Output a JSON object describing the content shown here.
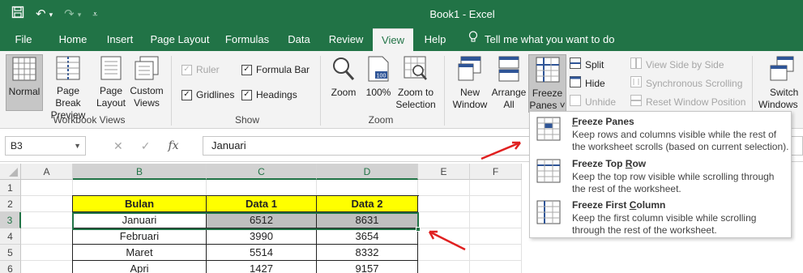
{
  "window": {
    "title": "Book1  -  Excel"
  },
  "menu": {
    "tabs": [
      {
        "label": "File"
      },
      {
        "label": "Home"
      },
      {
        "label": "Insert"
      },
      {
        "label": "Page Layout"
      },
      {
        "label": "Formulas"
      },
      {
        "label": "Data"
      },
      {
        "label": "Review"
      },
      {
        "label": "View",
        "active": true
      },
      {
        "label": "Help"
      }
    ],
    "tell_me": "Tell me what you want to do"
  },
  "ribbon": {
    "workbook_views": {
      "label": "Workbook Views",
      "normal": "Normal",
      "page_break_1": "Page Break",
      "page_break_2": "Preview",
      "page_layout_1": "Page",
      "page_layout_2": "Layout",
      "custom_1": "Custom",
      "custom_2": "Views"
    },
    "show": {
      "label": "Show",
      "ruler": "Ruler",
      "formula_bar": "Formula Bar",
      "gridlines": "Gridlines",
      "headings": "Headings"
    },
    "zoom": {
      "label": "Zoom",
      "zoom": "Zoom",
      "hundred": "100%",
      "zoom_sel_1": "Zoom to",
      "zoom_sel_2": "Selection"
    },
    "window": {
      "new_window_1": "New",
      "new_window_2": "Window",
      "arrange_1": "Arrange",
      "arrange_2": "All",
      "freeze_1": "Freeze",
      "freeze_2": "Panes ˅",
      "split": "Split",
      "hide": "Hide",
      "unhide": "Unhide",
      "side_by_side": "View Side by Side",
      "sync_scroll": "Synchronous Scrolling",
      "reset_pos": "Reset Window Position",
      "switch_1": "Switch",
      "switch_2": "Windows"
    }
  },
  "formula_bar": {
    "name_box": "B3",
    "value": "Januari",
    "fx": "fx"
  },
  "grid": {
    "columns": [
      "A",
      "B",
      "C",
      "D",
      "E",
      "F"
    ],
    "rows": [
      "1",
      "2",
      "3",
      "4",
      "5",
      "6"
    ],
    "table_header": [
      "Bulan",
      "Data 1",
      "Data 2"
    ],
    "table_rows": [
      [
        "Januari",
        "6512",
        "8631"
      ],
      [
        "Februari",
        "3990",
        "3654"
      ],
      [
        "Maret",
        "5514",
        "8332"
      ],
      [
        "Apri",
        "1427",
        "9157"
      ]
    ]
  },
  "freeze_menu": {
    "items": [
      {
        "title_u": "F",
        "title_rest": "reeze Panes",
        "desc": "Keep rows and columns visible while the rest of the worksheet scrolls (based on current selection)."
      },
      {
        "title_pre": "Freeze Top ",
        "title_u": "R",
        "title_rest": "ow",
        "desc": "Keep the top row visible while scrolling through the rest of the worksheet."
      },
      {
        "title_pre": "Freeze First ",
        "title_u": "C",
        "title_rest": "olumn",
        "desc": "Keep the first column visible while scrolling through the rest of the worksheet."
      }
    ]
  },
  "colors": {
    "excel_green": "#217346",
    "header_fill": "#ffff00",
    "highlight_fill": "#bfbfbf",
    "arrow": "#e02020"
  }
}
